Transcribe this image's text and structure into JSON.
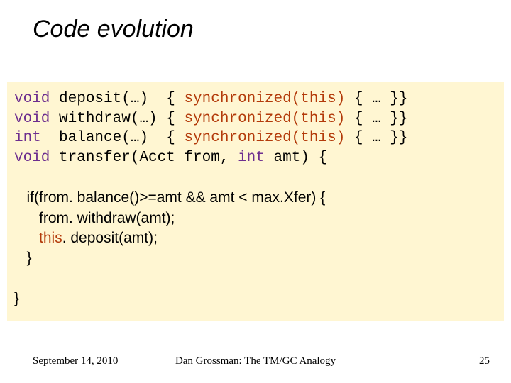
{
  "slide": {
    "title": "Code evolution",
    "code_signatures_html": "<span class=\"kw\">void</span> deposit(…)  { <span class=\"sync\">synchronized(this)</span> { … }}\n<span class=\"kw\">void</span> withdraw(…) { <span class=\"sync\">synchronized(this)</span> { … }}\n<span class=\"kw\">int</span>  balance(…)  { <span class=\"sync\">synchronized(this)</span> { … }}\n<span class=\"kw\">void</span> transfer(Acct from, <span class=\"kw\">int</span> amt) {",
    "code_body_html": "\n   if(from. balance()&gt;=amt &amp;&amp; amt &lt; max.Xfer) {\n      from. withdraw(amt);\n      <span class=\"sync\">this</span>. deposit(amt);\n   }\n\n}"
  },
  "footer": {
    "date": "September 14, 2010",
    "mid": "Dan Grossman: The TM/GC Analogy",
    "page": "25"
  }
}
